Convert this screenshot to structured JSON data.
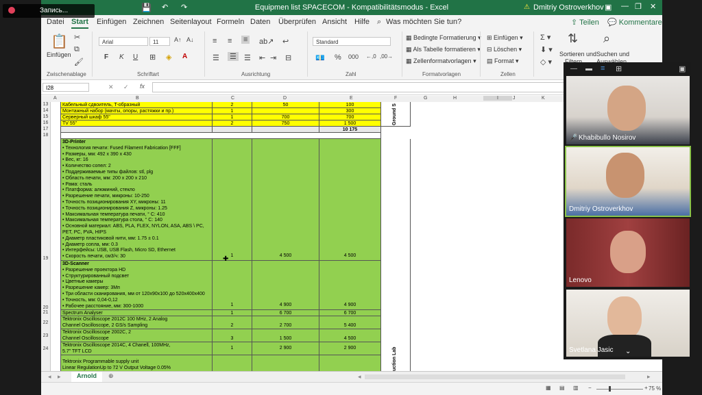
{
  "recording": {
    "label": "Запись..."
  },
  "excel": {
    "title": "Equipmen list SPACECOM  -  Kompatibilitätsmodus  -  Excel",
    "user": "Dmitriy Ostroverkhov",
    "menu": [
      "Datei",
      "Start",
      "Einfügen",
      "Zeichnen",
      "Seitenlayout",
      "Formeln",
      "Daten",
      "Überprüfen",
      "Ansicht",
      "Hilfe"
    ],
    "tell_me": "Was möchten Sie tun?",
    "share": "Teilen",
    "comments": "Kommentare",
    "ribbon": {
      "paste": "Einfügen",
      "clipboard": "Zwischenablage",
      "font_name": "Arial",
      "font_size": "11",
      "font_group": "Schriftart",
      "align_group": "Ausrichtung",
      "number_format": "Standard",
      "number_group": "Zahl",
      "cond_format": "Bedingte Formatierung",
      "as_table": "Als Tabelle formatieren",
      "cell_styles": "Zellenformatvorlagen",
      "styles_group": "Formatvorlagen",
      "insert": "Einfügen",
      "delete": "Löschen",
      "format": "Format",
      "cells_group": "Zellen",
      "sort": "Sortieren und",
      "sort2": "Filtern",
      "find": "Suchen und",
      "find2": "Auswählen"
    },
    "name_box": "I28",
    "columns": [
      "A",
      "B",
      "C",
      "D",
      "E",
      "F",
      "G",
      "H",
      "I",
      "J",
      "K"
    ],
    "rows": [
      {
        "n": "13",
        "b": "Кабельный сдвоитель, T-образный",
        "c": "2",
        "d": "50",
        "e": "100"
      },
      {
        "n": "14",
        "b": "Монтажный набор (мачты, опоры, растяжки и пр.)",
        "c": "1",
        "d": "",
        "e": "300"
      },
      {
        "n": "15",
        "b": "Серверный шкаф 55\"",
        "c": "1",
        "d": "700",
        "e": "700"
      },
      {
        "n": "16",
        "b": "TV 55\"",
        "c": "2",
        "d": "750",
        "e": "1 500"
      },
      {
        "n": "17",
        "b": "",
        "c": "",
        "d": "",
        "e": "10 175"
      },
      {
        "n": "18",
        "b": "",
        "c": "",
        "d": "",
        "e": ""
      }
    ],
    "side_label_top": "Ground S",
    "side_label_bottom": "uction Lab",
    "printer": {
      "n": "19",
      "c": "1",
      "d": "4 500",
      "e": "4 500",
      "title": "3D-Printer",
      "lines": [
        "• Технология печати: Fused Filament Fabrication [FFF]",
        "• Размеры, мм: 492 x 390 x 430",
        "• Вес, кг: 16",
        "• Количество сопел: 2",
        "• Поддерживаемые типы файлов: stl, plg",
        "• Область печати, мм: 200 x 200 x 210",
        "• Рама: сталь",
        "• Платформа: алюминий, стекло",
        "• Разрешение печати, микроны: 10-250",
        "• Точность позиционирования XY, микроны: 11",
        "• Точность позиционирования Z, микроны: 1.25",
        "• Максимальная температура печати, ° С: 410",
        "• Максимальная температура стола, ° С: 140",
        "• Основной материал: ABS, PLA, FLEX, NYLON, ASA, ABS \\ PC,",
        "PET, PC, PVA, HIPS",
        "• Диаметр пластиковой нити, мм: 1.75 ± 0.1",
        "• Диаметр сопла, мм: 0.3",
        "• Интерфейсы: USB, USB Flash, Micro SD, Ethernet",
        "• Скорость печати, см3/ч: 30"
      ]
    },
    "scanner": {
      "n": "20",
      "c": "1",
      "d": "4 900",
      "e": "4 900",
      "title": "3D-Scanner",
      "lines": [
        "• Разрешение проектора HD",
        "• Структурированный подсвет",
        "• Цветные камеры",
        "• Разрешение камер: 3Мп",
        "• Три области сканирования, мм от 120x90x100 до 520x400x400",
        "• Точность, мм: 0,04-0,12",
        "• Рабочее расстояние, мм: 300-1000"
      ]
    },
    "rows2": [
      {
        "n": "21",
        "b1": "Spectrum Analyser",
        "b2": "",
        "c": "1",
        "d": "6 700",
        "e": "6 700"
      },
      {
        "n": "22",
        "b1": "Tektronix Oscilloscope 2012C 100 MHz, 2 Analog",
        "b2": "Channel Oscilloscope, 2 GS/s Sampling",
        "c": "2",
        "d": "2 700",
        "e": "5 400"
      },
      {
        "n": "23",
        "b1": "Tektronix Oscilloscope 2002C, 2",
        "b2": "Channel Oscilloscope",
        "c": "3",
        "d": "1 500",
        "e": "4 500"
      },
      {
        "n": "24",
        "b1": "Tektronix Oscilloscope 2014C, 4 Chanell, 100MHz,",
        "b2": "5.7\"  TFT LCD",
        "c": "1",
        "d": "2 900",
        "e": "2 900"
      }
    ],
    "last_rows": [
      "Tektronix Programmable supply unit",
      "Linear RegulationUp to 72 V Output Voltage 0.05%"
    ],
    "sheet_tab": "Arnold",
    "zoom": "75 %"
  },
  "video": {
    "participants": [
      {
        "name": "Khabibullo Nosirov",
        "muted": true
      },
      {
        "name": "Dmitriy Ostroverkhov",
        "muted": false
      },
      {
        "name": "Lenovo",
        "muted": false
      },
      {
        "name": "Svetlana Jasic",
        "muted": false
      }
    ]
  }
}
